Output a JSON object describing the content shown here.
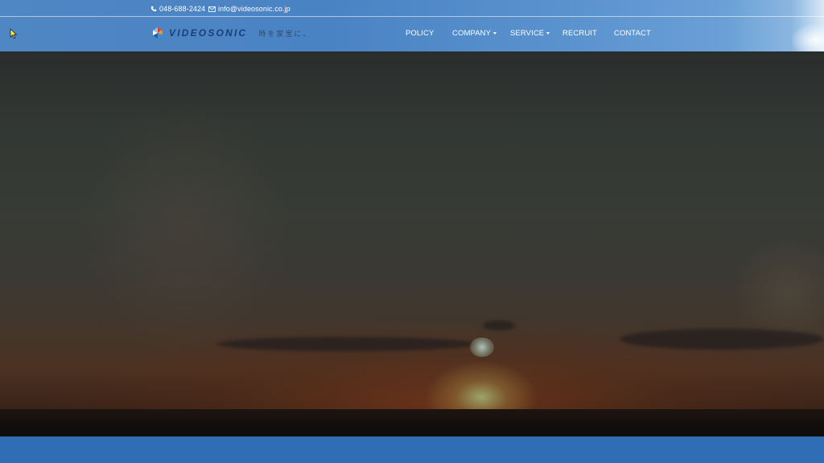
{
  "topbar": {
    "phone": "048-688-2424",
    "email": "info@videosonic.co.jp"
  },
  "logo": {
    "wordmark": "VIDEOSONIC",
    "tagline": "時を家宝に。"
  },
  "nav": {
    "items": [
      {
        "label": "POLICY",
        "has_dropdown": false
      },
      {
        "label": "COMPANY",
        "has_dropdown": true
      },
      {
        "label": "SERVICE",
        "has_dropdown": true
      },
      {
        "label": "RECRUIT",
        "has_dropdown": false
      },
      {
        "label": "CONTACT",
        "has_dropdown": false
      }
    ]
  },
  "hero": {
    "image": "sunset-sky-video"
  },
  "colors": {
    "header_blue": "#4f86c4",
    "footer_blue": "#2f6db4",
    "logo_navy": "#1a3f7a"
  },
  "icons": {
    "phone": "phone-icon",
    "mail": "mail-icon",
    "caret": "caret-down-icon",
    "cursor": "mouse-cursor-icon"
  }
}
